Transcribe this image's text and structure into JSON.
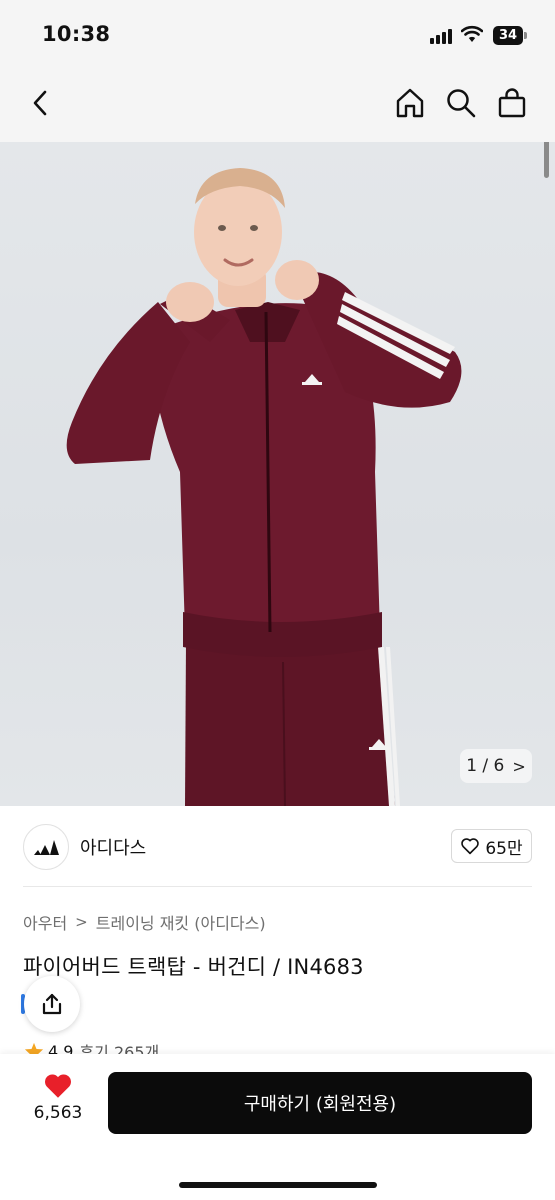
{
  "status_bar": {
    "time": "10:38",
    "battery": "34"
  },
  "nav": {
    "back_icon": "chevron-left-icon",
    "home_icon": "home-icon",
    "search_icon": "search-icon",
    "bag_icon": "shopping-bag-icon"
  },
  "gallery": {
    "counter": "1 / 6",
    "counter_chevron": ">"
  },
  "brand": {
    "name": "아디다스",
    "likes": "65만"
  },
  "breadcrumb": {
    "category": "아우터",
    "separator": ">",
    "subcategory": "트레이닝 재킷 (아디다스)"
  },
  "product": {
    "title": "파이어버드 트랙탑 - 버건디 / IN4683"
  },
  "rating": {
    "score": "4.9",
    "reviews": "후기 265개"
  },
  "bottom": {
    "wishlist_count": "6,563",
    "buy_label": "구매하기 (회원전용)"
  },
  "colors": {
    "accent_heart": "#e8202a",
    "jacket": "#6b1a2c",
    "button": "#0b0b0b",
    "star": "#f4a623"
  }
}
